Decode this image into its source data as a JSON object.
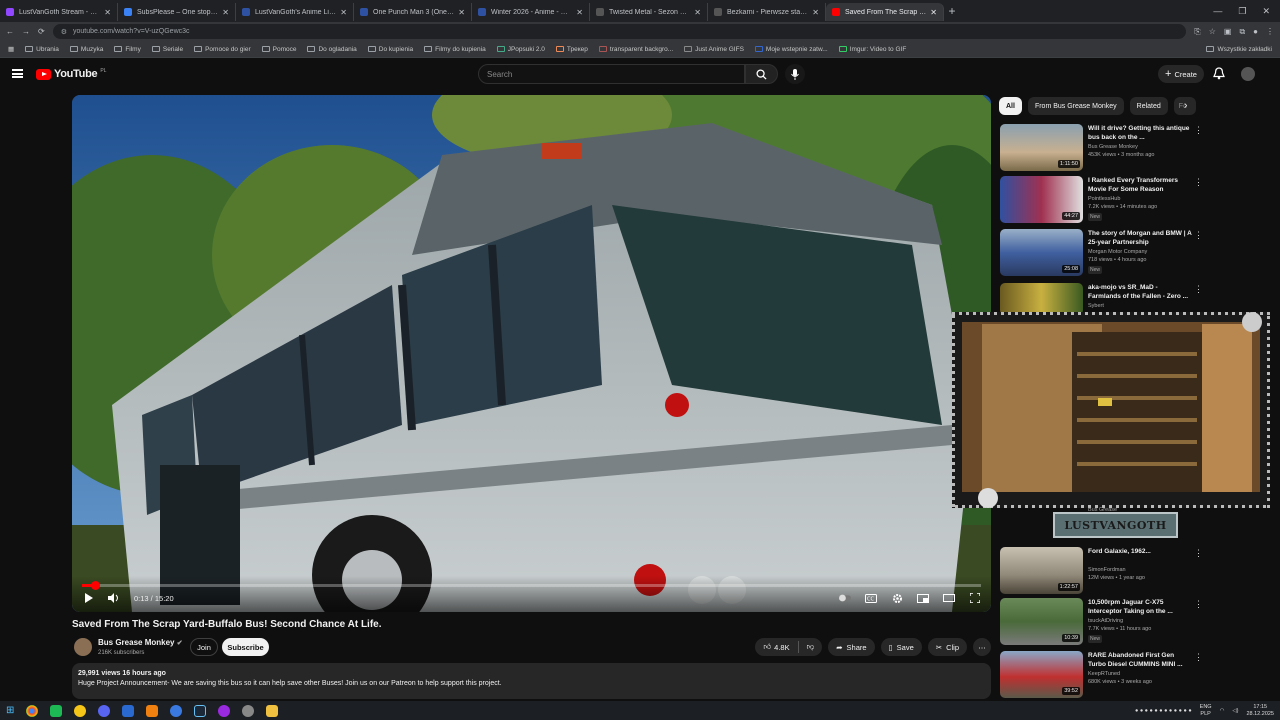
{
  "browser": {
    "tabs": [
      {
        "title": "LustVanGoth Stream - Watch L",
        "color": "#9146ff"
      },
      {
        "title": "SubsPlease – One stop shop fo",
        "color": "#3b82f6"
      },
      {
        "title": "LustVanGoth's Anime List - My",
        "color": "#2e51a2"
      },
      {
        "title": "One Punch Man 3 (One-Punch",
        "color": "#2e51a2"
      },
      {
        "title": "Winter 2026 - Anime - MyAnim",
        "color": "#2e51a2"
      },
      {
        "title": "Twisted Metal - Sezon 1 Odcin",
        "color": "#555555"
      },
      {
        "title": "Bezkarni - Pierwsze starcie / Th",
        "color": "#555555"
      },
      {
        "title": "Saved From The Scrap Yard-Bu",
        "color": "#ff0000",
        "active": true
      }
    ],
    "url": "youtube.com/watch?v=V-uzQGewc3c",
    "bookmarks": [
      "Ubrania",
      "Muzyka",
      "Filmy",
      "Seriale",
      "Pomoce do gier",
      "Pomoce",
      "Do ogladania",
      "Do kupienia",
      "Filmy do kupienia",
      "JPopsuki 2.0",
      "Трекер",
      "transparent backgro...",
      "Just Anime GIFS",
      "Moje wstepnie zatw...",
      "Imgur: Video to GIF"
    ],
    "bookmarks_right": "Wszystkie zakładki"
  },
  "youtube": {
    "logo": "YouTube",
    "country": "PL",
    "search_placeholder": "Search",
    "create_label": "Create",
    "video": {
      "title": "Saved From The Scrap Yard-Buffalo Bus! Second Chance At Life.",
      "time": "0:13 / 15:20",
      "progress": 0.014
    },
    "channel": {
      "name": "Bus Grease Monkey",
      "subs": "216K subscribers"
    },
    "join_label": "Join",
    "subscribe_label": "Subscribe",
    "actions": {
      "likes": "4.8K",
      "share": "Share",
      "save": "Save",
      "clip": "Clip"
    },
    "description": {
      "meta": "29,991 views  16 hours ago",
      "text": "Huge Project Announcement- We are saving this bus so it can help save other Buses!   Join us on our Patreon to help support this project."
    },
    "chips": [
      "All",
      "From Bus Grease Monkey",
      "Related",
      "Fo"
    ],
    "recommendations": [
      {
        "title": "Will it drive?  Getting this antique bus back on the ...",
        "channel": "Bus Grease Monkey",
        "views": "453K views • 3 months ago",
        "duration": "1:11:50",
        "new": ""
      },
      {
        "title": "I Ranked Every Transformers Movie For Some Reason",
        "channel": "PointlessHub",
        "views": "7.2K views • 14 minutes ago",
        "duration": "44:27",
        "new": "New"
      },
      {
        "title": "The story of Morgan and BMW | A 25-year Partnership",
        "channel": "Morgan Motor Company",
        "views": "718 views • 4 hours ago",
        "duration": "25:08",
        "new": "New"
      },
      {
        "title": "aka-mojo vs SR_MaD - Farmlands of the Fallen - Zero ...",
        "channel": "Sybert",
        "views": "",
        "duration": "",
        "new": ""
      },
      {
        "title": "Ford Galaxie, 1962...",
        "channel": "SimonFordman",
        "views": "12M views • 1 year ago",
        "duration": "1:22:57",
        "new": ""
      },
      {
        "title": "10,500rpm Jaguar C-X75 Interceptor Taking on the ...",
        "channel": "tsuckAtDriving",
        "views": "7.7K views • 11 hours ago",
        "duration": "10:39",
        "new": "New"
      },
      {
        "title": "RARE Abandoned First Gen Turbo Diesel CUMMINS MINI ...",
        "channel": "KeepRTuned",
        "views": "680K views • 3 weeks ago",
        "duration": "39:52",
        "new": ""
      }
    ],
    "partial_channel": "Bus Grease"
  },
  "overlay": {
    "tag": "LUSTVANGOTH"
  },
  "taskbar": {
    "lang": "ENG",
    "layout": "PLP",
    "time": "17:15",
    "date": "28.12.2025"
  },
  "colors": {
    "yt_red": "#ff0000",
    "bg": "#0f0f0f",
    "chip_bg": "#272727"
  }
}
